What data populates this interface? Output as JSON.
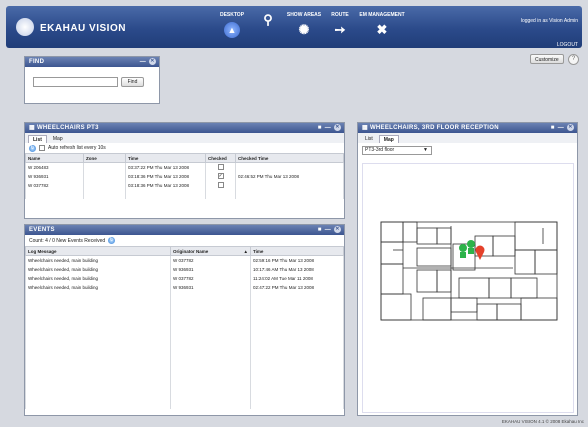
{
  "app": {
    "title": "EKAHAU VISION",
    "logged_in_text": "logged in as Vision Admin",
    "logout_label": "LOGOUT",
    "footer": "EKAHAU VISION 4.1  © 2008 Ekahau Inc"
  },
  "nav": [
    {
      "label": "DESKTOP",
      "icon": "desktop-icon",
      "active": true
    },
    {
      "label": "",
      "icon": "search-icon",
      "active": false
    },
    {
      "label": "SHOW AREAS",
      "icon": "satellite-icon",
      "active": false
    },
    {
      "label": "ROUTE",
      "icon": "route-icon",
      "active": false
    },
    {
      "label": "EM MANAGEMENT",
      "icon": "tools-icon",
      "active": false
    }
  ],
  "toolbar": {
    "customize_label": "Customize",
    "help_label": "?"
  },
  "find_panel": {
    "title": "FIND",
    "button_label": "Find",
    "input_value": ""
  },
  "wheelchairs_panel": {
    "title": "WHEELCHAIRS PT3",
    "tabs": [
      "List",
      "Map"
    ],
    "auto_refresh_label": "Auto refresh list every 10s",
    "columns": [
      "Name",
      "Zone",
      "Time",
      "Checked",
      "Checked Time"
    ],
    "rows": [
      {
        "name": "W 206483",
        "zone": "",
        "time": "03:37:22 PM  Thu Mar 13 2008",
        "checked": false,
        "checked_time": ""
      },
      {
        "name": "W 936931",
        "zone": "",
        "time": "03:18:36 PM  Thu Mar 13 2008",
        "checked": true,
        "checked_time": "02:46:52 PM  Thu Mar 13 2008"
      },
      {
        "name": "W 037782",
        "zone": "",
        "time": "03:18:36 PM  Thu Mar 13 2008",
        "checked": false,
        "checked_time": ""
      }
    ]
  },
  "events_panel": {
    "title": "EVENTS",
    "count_text": "Count: 4  /  0 New Events Received",
    "columns": [
      "Log Message",
      "Originator Name",
      "Time"
    ],
    "rows": [
      {
        "message": "Wheelchairs needed, main building",
        "originator": "W 037782",
        "time": "02:59:16 PM  Thu Mar 13 2008"
      },
      {
        "message": "Wheelchairs needed, main building",
        "originator": "W 936931",
        "time": "10:17:46 AM  Thu Mar 13 2008"
      },
      {
        "message": "Wheelchairs needed, main building",
        "originator": "W 037782",
        "time": "11:24:02 AM  Tue Mar 11 2008"
      },
      {
        "message": "Wheelchairs needed, main building",
        "originator": "W 936931",
        "time": "02:47:22 PM  Thu Mar 13 2008"
      }
    ]
  },
  "map_panel": {
    "title": "WHEELCHAIRS, 3RD FLOOR RECEPTION",
    "tabs": [
      "List",
      "Map"
    ],
    "floor_select": "PT3-3rd floor"
  }
}
